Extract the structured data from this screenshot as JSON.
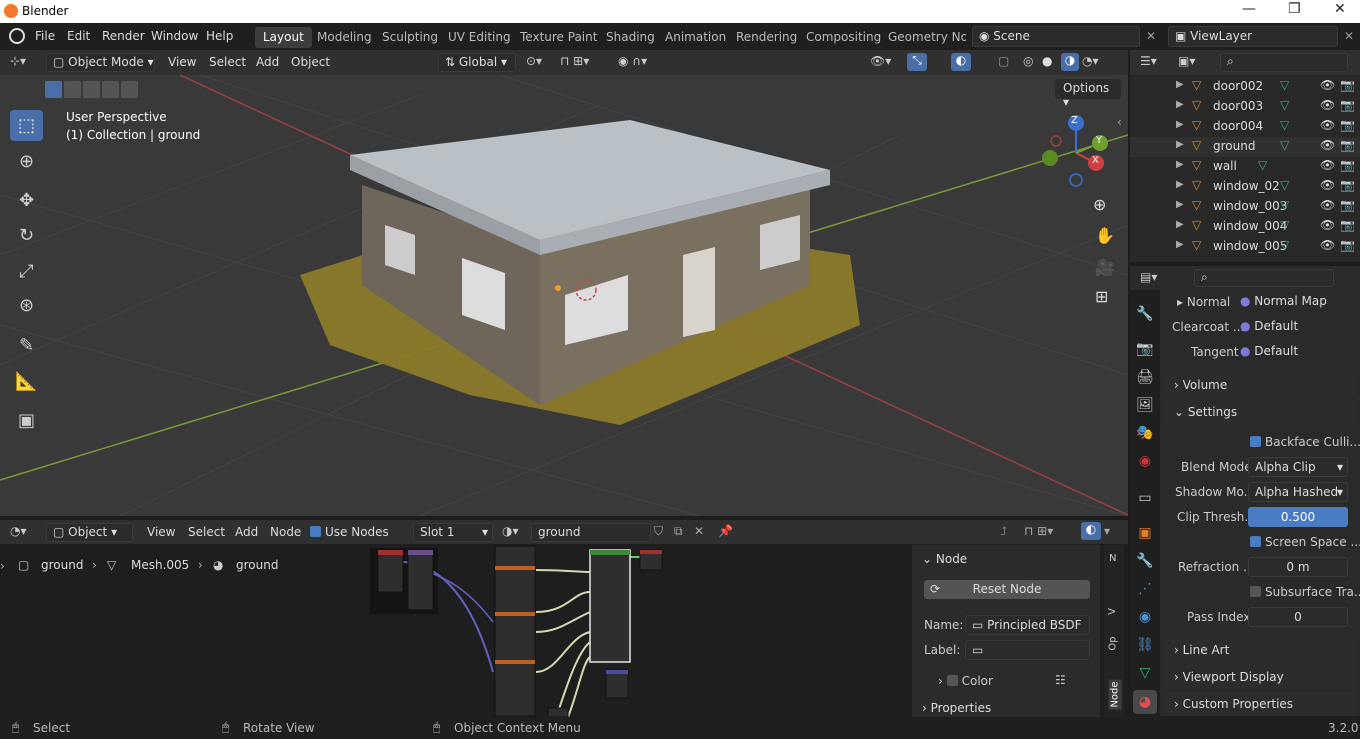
{
  "window": {
    "title": "Blender"
  },
  "menu": [
    "File",
    "Edit",
    "Render",
    "Window",
    "Help"
  ],
  "workspaces": [
    "Layout",
    "Modeling",
    "Sculpting",
    "UV Editing",
    "Texture Paint",
    "Shading",
    "Animation",
    "Rendering",
    "Compositing",
    "Geometry Noc"
  ],
  "scene": {
    "name": "Scene",
    "view_layer": "ViewLayer"
  },
  "viewport": {
    "mode": "Object Mode",
    "menus": [
      "View",
      "Select",
      "Add",
      "Object"
    ],
    "orientation": "Global",
    "options": "Options",
    "info_line1": "User Perspective",
    "info_line2": "(1) Collection | ground",
    "axes": {
      "x": "X",
      "y": "Y",
      "z": "Z"
    }
  },
  "outliner": {
    "items": [
      "door002",
      "door003",
      "door004",
      "ground",
      "wall",
      "window_02",
      "window_003",
      "window_004",
      "window_005"
    ]
  },
  "properties": {
    "normal": "Normal",
    "normal_value": "Normal Map",
    "clearcoat": "Clearcoat ...",
    "clearcoat_value": "Default",
    "tangent": "Tangent",
    "tangent_value": "Default",
    "volume": "Volume",
    "settings": "Settings",
    "backface": "Backface Culli...",
    "blend_mode_label": "Blend Mode",
    "blend_mode": "Alpha Clip",
    "shadow_label": "Shadow Mo...",
    "shadow_mode": "Alpha Hashed",
    "clip_label": "Clip Thresh...",
    "clip_value": "0.500",
    "screen_space": "Screen Space ...",
    "refraction_label": "Refraction ...",
    "refraction_value": "0 m",
    "subsurface": "Subsurface Tra...",
    "pass_label": "Pass Index",
    "pass_value": "0",
    "line_art": "Line Art",
    "viewport_display": "Viewport Display",
    "custom_props": "Custom Properties"
  },
  "node_editor": {
    "type": "Object",
    "menus": [
      "View",
      "Select",
      "Add",
      "Node"
    ],
    "use_nodes": "Use Nodes",
    "slot": "Slot 1",
    "material": "ground",
    "breadcrumb": [
      "ground",
      "Mesh.005",
      "ground"
    ],
    "node_panel": {
      "title": "Node",
      "reset": "Reset Node",
      "name_label": "Name:",
      "name_value": "Principled BSDF",
      "label_label": "Label:",
      "label_value": "",
      "color": "Color",
      "properties": "Properties"
    },
    "side_tabs": [
      "N",
      "V",
      "Op",
      "Node"
    ]
  },
  "status": {
    "select": "Select",
    "rotate": "Rotate View",
    "context": "Object Context Menu",
    "version": "3.2.0"
  }
}
